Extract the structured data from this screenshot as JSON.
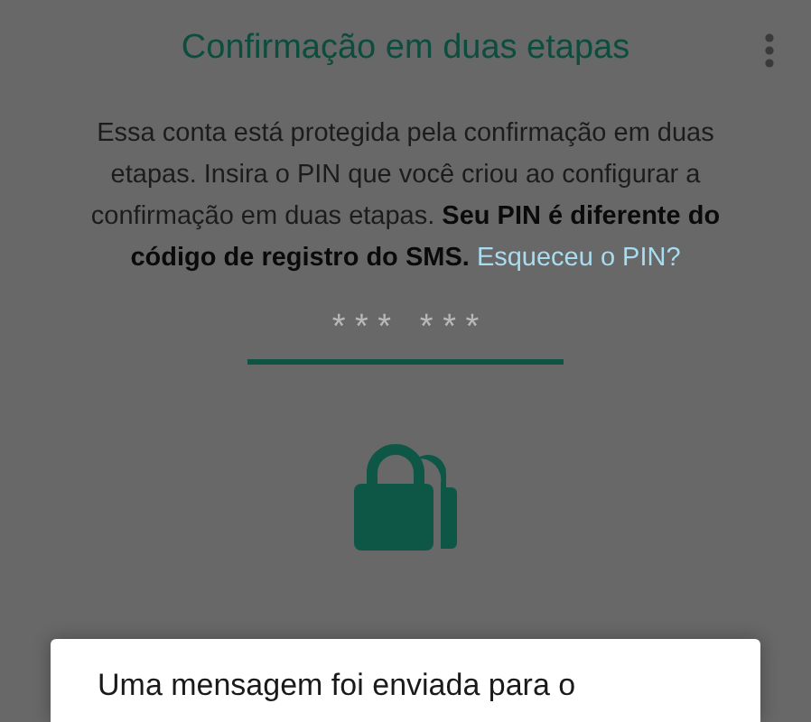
{
  "header": {
    "title": "Confirmação em duas etapas"
  },
  "description": "Essa conta está protegida pela confirmação em duas etapas. Insira o PIN que você criou ao configurar a confirmação em duas etapas. **Seu PIN é diferente do código de registro do SMS.**",
  "forgot_link": "Esqueceu o PIN?",
  "pin_field": {
    "placeholder": "* * *   * * *"
  },
  "dialog": {
    "message": "Uma mensagem foi enviada para o"
  }
}
